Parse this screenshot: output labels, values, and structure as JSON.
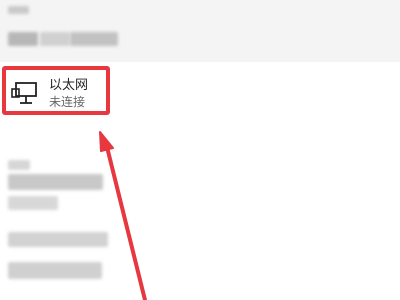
{
  "network_list": {
    "items": [
      {
        "name": "以太网",
        "status": "未连接",
        "icon": "ethernet-icon"
      }
    ]
  },
  "annotation": {
    "highlight_color": "#e7383f",
    "arrow_color": "#e7383f"
  },
  "colors": {
    "panel_background": "#f4f4f4",
    "page_background": "#ffffff"
  }
}
